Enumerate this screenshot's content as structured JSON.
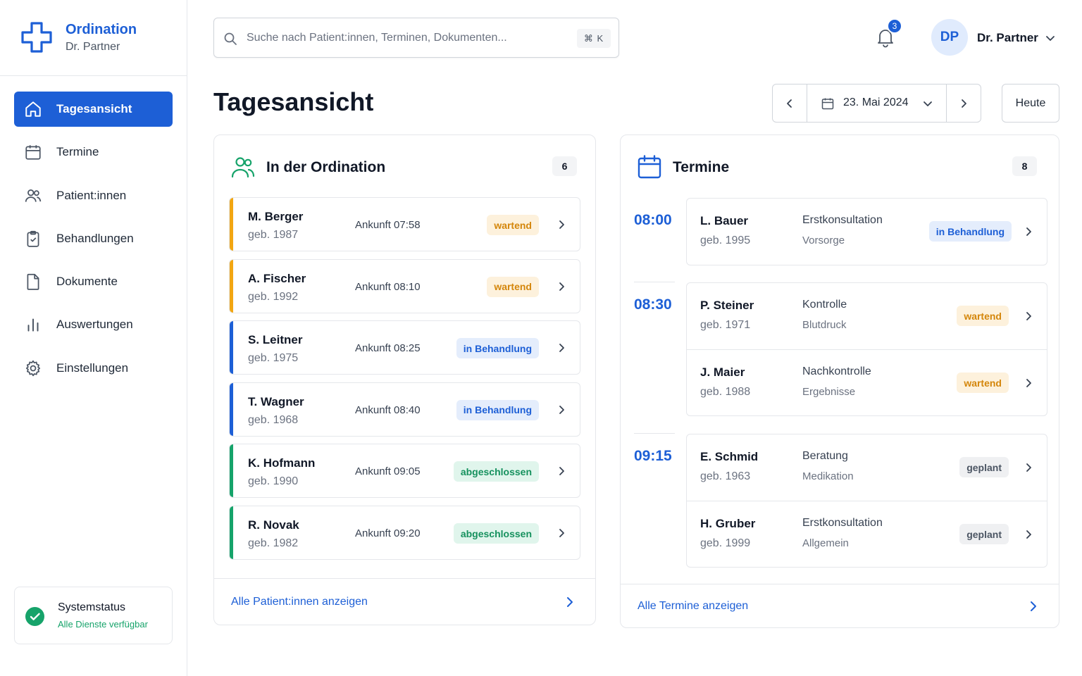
{
  "brand": {
    "title": "Ordination",
    "subtitle": "Dr. Partner"
  },
  "nav": [
    {
      "label": "Tagesansicht",
      "icon": "home-icon",
      "active": true
    },
    {
      "label": "Termine",
      "icon": "calendar-icon"
    },
    {
      "label": "Patient:innen",
      "icon": "users-icon"
    },
    {
      "label": "Behandlungen",
      "icon": "clipboard-check-icon"
    },
    {
      "label": "Dokumente",
      "icon": "document-icon"
    },
    {
      "label": "Auswertungen",
      "icon": "bar-chart-icon"
    },
    {
      "label": "Einstellungen",
      "icon": "gear-icon"
    }
  ],
  "system_status": {
    "title": "Systemstatus",
    "detail": "Alle Dienste verfügbar",
    "color": "#16a36a"
  },
  "search": {
    "placeholder": "Suche nach Patient:innen, Terminen, Dokumenten...",
    "shortcut": "⌘ K"
  },
  "notifications": {
    "count": "3"
  },
  "user": {
    "initials": "DP",
    "name": "Dr. Partner"
  },
  "page": {
    "title": "Tagesansicht"
  },
  "date_nav": {
    "date": "23. Mai 2024",
    "today_label": "Heute"
  },
  "colors": {
    "accent": "#1d5fd6",
    "waiting": "#f2a612",
    "in_treatment": "#1d5fd6",
    "done": "#16a36a"
  },
  "in_ordination": {
    "title": "In der Ordination",
    "count": "6",
    "patients": [
      {
        "name": "M. Berger",
        "birth": "geb. 1987",
        "arrival": "Ankunft 07:58",
        "status": "wartend",
        "status_kind": "wartend"
      },
      {
        "name": "A. Fischer",
        "birth": "geb. 1992",
        "arrival": "Ankunft 08:10",
        "status": "wartend",
        "status_kind": "wartend"
      },
      {
        "name": "S. Leitner",
        "birth": "geb. 1975",
        "arrival": "Ankunft 08:25",
        "status": "in Behandlung",
        "status_kind": "behandlung"
      },
      {
        "name": "T. Wagner",
        "birth": "geb. 1968",
        "arrival": "Ankunft 08:40",
        "status": "in Behandlung",
        "status_kind": "behandlung"
      },
      {
        "name": "K. Hofmann",
        "birth": "geb. 1990",
        "arrival": "Ankunft 09:05",
        "status": "abgeschlossen",
        "status_kind": "abgeschlossen"
      },
      {
        "name": "R. Novak",
        "birth": "geb. 1982",
        "arrival": "Ankunft 09:20",
        "status": "abgeschlossen",
        "status_kind": "abgeschlossen"
      }
    ],
    "footer_link": "Alle Patient:innen anzeigen"
  },
  "appointments": {
    "title": "Termine",
    "count": "8",
    "slots": [
      {
        "time": "08:00",
        "items": [
          {
            "name": "L. Bauer",
            "birth": "geb. 1995",
            "type": "Erstkonsultation",
            "subtype": "Vorsorge",
            "status": "in Behandlung",
            "status_kind": "behandlung"
          }
        ]
      },
      {
        "time": "08:30",
        "items": [
          {
            "name": "P. Steiner",
            "birth": "geb. 1971",
            "type": "Kontrolle",
            "subtype": "Blutdruck",
            "status": "wartend",
            "status_kind": "wartend"
          },
          {
            "name": "J. Maier",
            "birth": "geb. 1988",
            "type": "Nachkontrolle",
            "subtype": "Ergebnisse",
            "status": "wartend",
            "status_kind": "wartend"
          }
        ]
      },
      {
        "time": "09:15",
        "items": [
          {
            "name": "E. Schmid",
            "birth": "geb. 1963",
            "type": "Beratung",
            "subtype": "Medikation",
            "status": "geplant",
            "status_kind": "geplant"
          },
          {
            "name": "H. Gruber",
            "birth": "geb. 1999",
            "type": "Erstkonsultation",
            "subtype": "Allgemein",
            "status": "geplant",
            "status_kind": "geplant"
          }
        ]
      }
    ],
    "footer_link": "Alle Termine anzeigen"
  }
}
